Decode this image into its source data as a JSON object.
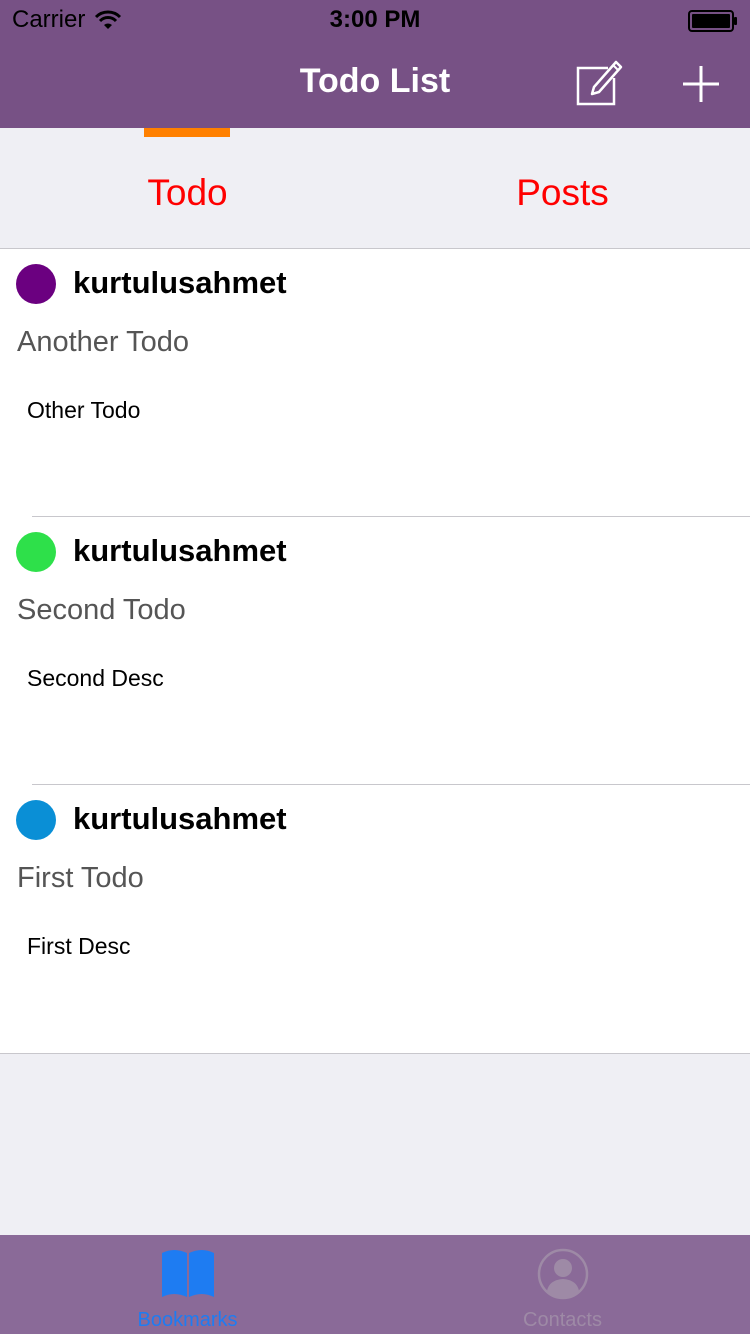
{
  "status_bar": {
    "carrier": "Carrier",
    "time": "3:00 PM"
  },
  "nav": {
    "title": "Todo List",
    "edit_icon": "compose-icon",
    "add_icon": "plus-icon"
  },
  "tabs": [
    {
      "label": "Todo",
      "selected": true
    },
    {
      "label": "Posts",
      "selected": false
    }
  ],
  "todos": [
    {
      "user": "kurtulusahmet",
      "title": "Another Todo",
      "desc": "Other Todo",
      "color": "#6b0080"
    },
    {
      "user": "kurtulusahmet",
      "title": "Second Todo",
      "desc": "Second Desc",
      "color": "#2ee04a"
    },
    {
      "user": "kurtulusahmet",
      "title": "First Todo",
      "desc": "First Desc",
      "color": "#0a8fd6"
    }
  ],
  "tabbar": {
    "bookmarks": {
      "label": "Bookmarks",
      "icon": "book-icon",
      "active": true,
      "color": "#1e7cf2"
    },
    "contacts": {
      "label": "Contacts",
      "icon": "person-icon",
      "active": false,
      "color": "#9e8aa6"
    }
  },
  "colors": {
    "nav_bg": "#775185",
    "tab_text": "#ff0000",
    "tab_indicator": "#ff8000"
  }
}
